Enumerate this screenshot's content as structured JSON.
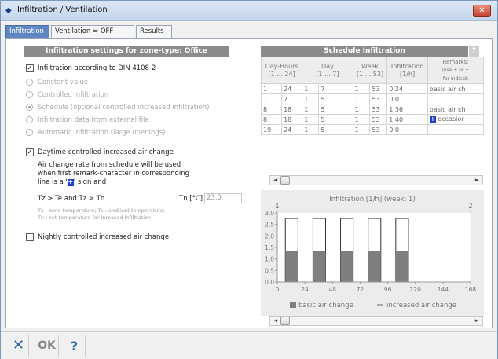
{
  "window": {
    "title": "Infiltration / Ventilation",
    "close_label": "✕"
  },
  "tabs": [
    {
      "label": "Infiltration"
    },
    {
      "label": "Ventilation = OFF"
    },
    {
      "label": "Results"
    }
  ],
  "left": {
    "section_title": "Infiltration settings for zone-type: Office",
    "din_checkbox_label": "Infiltration according to DIN 4108-2",
    "din_checked": true,
    "radio_options": [
      {
        "label": "Constant value",
        "selected": false
      },
      {
        "label": "Controlled infiltration",
        "selected": false
      },
      {
        "label": "Schedule (optional controlled increased infiltration)",
        "selected": true
      },
      {
        "label": "Infiltration data from external file",
        "selected": false
      },
      {
        "label": "Automatic infiltration (large openings)",
        "selected": false
      }
    ],
    "daytime_label": "Daytime controlled increased air change",
    "daytime_checked": true,
    "daytime_desc_1": "Air change rate from schedule will be used",
    "daytime_desc_2": "when first remark-character in corresponding",
    "daytime_desc_3_pre": "line is a '",
    "daytime_desc_3_plus": "+",
    "daytime_desc_3_post": "' sign and",
    "condition": "Tz > Te  and  Tz > Tn",
    "tn_label": "Tn  [°C]",
    "tn_value": "23.0",
    "legend_1": "Tz : zone-temperature; Te : ambient temperature;",
    "legend_2": "Tn : set-temperature for inreased infiltration",
    "nightly_label": "Nightly controlled increased air change",
    "nightly_checked": false
  },
  "schedule": {
    "title": "Schedule Infiltration",
    "help": "?",
    "headers": [
      {
        "line1": "Day-Hours",
        "line2": "[1 ... 24]"
      },
      {
        "line1": "Day",
        "line2": "[1 ... 7]"
      },
      {
        "line1": "Week",
        "line2": "[1 ... 53]"
      },
      {
        "line1": "Infiltration",
        "line2": "[1/h]"
      },
      {
        "line1": "Remarks:",
        "line2": "(use + or +",
        "line3": "for indicati"
      }
    ],
    "rows": [
      [
        "1",
        "24",
        "1",
        "7",
        "1",
        "53",
        "0.24",
        "basic air ch",
        ""
      ],
      [
        "1",
        "7",
        "1",
        "5",
        "1",
        "53",
        "0.0",
        "",
        ""
      ],
      [
        "8",
        "18",
        "1",
        "5",
        "1",
        "53",
        "1.36",
        "basic air ch",
        ""
      ],
      [
        "8",
        "18",
        "1",
        "5",
        "1",
        "53",
        "1.40",
        "occasior",
        "+"
      ],
      [
        "19",
        "24",
        "1",
        "5",
        "1",
        "53",
        "0.0",
        "",
        ""
      ]
    ]
  },
  "chart_data": {
    "type": "bar",
    "title": "Infiltration [1/h]   (week: 1)",
    "top_markers": [
      "1",
      "2"
    ],
    "xticks": [
      "0",
      "24",
      "48",
      "72",
      "96",
      "120",
      "144",
      "168"
    ],
    "yticks": [
      "0.0",
      "0.5",
      "1.0",
      "1.5",
      "2.0",
      "2.5",
      "3.0"
    ],
    "xlim": [
      0,
      168
    ],
    "ylim": [
      0,
      3.0
    ],
    "series": [
      {
        "name": "basic air change",
        "color": "#7f7f7f",
        "segments": [
          [
            0,
            7,
            0.0
          ],
          [
            7,
            18,
            1.36
          ],
          [
            18,
            31,
            0.0
          ],
          [
            31,
            42,
            1.36
          ],
          [
            42,
            55,
            0.0
          ],
          [
            55,
            66,
            1.36
          ],
          [
            66,
            79,
            0.0
          ],
          [
            79,
            90,
            1.36
          ],
          [
            90,
            103,
            0.0
          ],
          [
            103,
            114,
            1.36
          ],
          [
            114,
            168,
            0.0
          ]
        ]
      },
      {
        "name": "increased air change",
        "color": "#333333",
        "segments": [
          [
            7,
            18,
            2.76
          ],
          [
            31,
            42,
            2.76
          ],
          [
            55,
            66,
            2.76
          ],
          [
            79,
            90,
            2.76
          ],
          [
            103,
            114,
            2.76
          ]
        ]
      }
    ]
  },
  "bottom": {
    "cancel_label": "✕",
    "ok_label": "OK",
    "help_label": "?"
  }
}
